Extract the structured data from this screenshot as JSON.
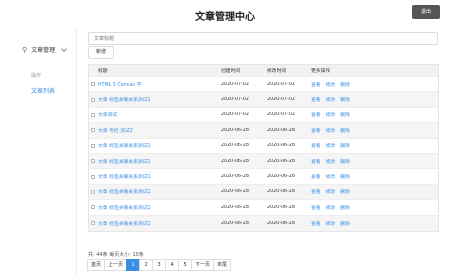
{
  "header": {
    "title": "文章管理中心",
    "logout_label": "退出"
  },
  "sidebar": {
    "menu_title": "文章管理",
    "group_label": "操作",
    "items": [
      {
        "label": "文章列表"
      }
    ]
  },
  "search": {
    "placeholder": "文章标题"
  },
  "toolbar": {
    "add_label": "新增"
  },
  "table": {
    "headers": [
      "标题",
      "创建时间",
      "修改时间",
      "更多操作"
    ],
    "ops": [
      "查看",
      "修改",
      "删除"
    ],
    "rows": [
      {
        "title": "HTML 5 Canvas 学",
        "created": "2020-07-02",
        "modified": "2020-07-02"
      },
      {
        "title": "文章 标签关联关系测试1",
        "created": "2020-07-02",
        "modified": "2020-07-02"
      },
      {
        "title": "文章测试",
        "created": "2020-07-02",
        "modified": "2020-07-02"
      },
      {
        "title": "文章 专栏 测试2",
        "created": "2020-06-28",
        "modified": "2020-06-28"
      },
      {
        "title": "文章 标签关联关系测试1",
        "created": "2020-06-28",
        "modified": "2020-06-28"
      },
      {
        "title": "文章 标签关联关系测试1",
        "created": "2020-06-28",
        "modified": "2020-06-28"
      },
      {
        "title": "文章 标签关联关系测试1",
        "created": "2020-06-28",
        "modified": "2020-06-28"
      },
      {
        "title": "文章 标签关联关系测试1",
        "created": "2020-06-28",
        "modified": "2020-06-28"
      },
      {
        "title": "文章 标签关联关系测试1",
        "created": "2020-06-28",
        "modified": "2020-06-28"
      },
      {
        "title": "文章 标签关联关系测试1",
        "created": "2020-06-28",
        "modified": "2020-06-28"
      }
    ]
  },
  "pagination": {
    "info": "共: 44条 每页大小: 10条",
    "first": "首页",
    "prev": "上一页",
    "pages": [
      "1",
      "2",
      "3",
      "4",
      "5"
    ],
    "next": "下一页",
    "last": "末尾"
  },
  "colors": {
    "accent": "#3a8ee6",
    "logout_bg": "#555555"
  },
  "icons": {
    "menu": "location-pin-icon",
    "expand": "chevron-down-icon"
  }
}
